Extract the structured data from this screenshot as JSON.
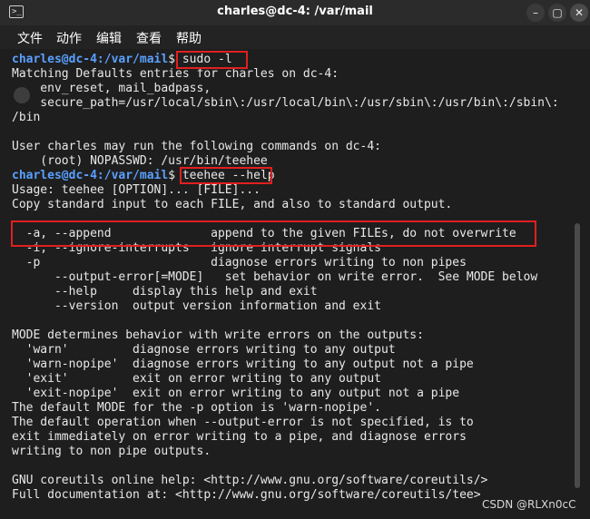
{
  "window": {
    "title": "charles@dc-4: /var/mail",
    "icon": "terminal-icon",
    "controls": {
      "minimize": "–",
      "maximize": "▢",
      "close": "✕"
    }
  },
  "menu": [
    "文件",
    "动作",
    "编辑",
    "查看",
    "帮助"
  ],
  "prompt": {
    "user": "charles@dc-4",
    "path": ":/var/mail",
    "symbol": "$"
  },
  "lines": [
    {
      "kind": "prompt",
      "cmd": " sudo -l"
    },
    {
      "kind": "text",
      "text": "Matching Defaults entries for charles on dc-4:"
    },
    {
      "kind": "text",
      "text": "    env_reset, mail_badpass,"
    },
    {
      "kind": "text",
      "text": "    secure_path=/usr/local/sbin\\:/usr/local/bin\\:/usr/sbin\\:/usr/bin\\:/sbin\\:"
    },
    {
      "kind": "text",
      "text": "/bin"
    },
    {
      "kind": "text",
      "text": ""
    },
    {
      "kind": "text",
      "text": "User charles may run the following commands on dc-4:"
    },
    {
      "kind": "text",
      "text": "    (root) NOPASSWD: /usr/bin/teehee"
    },
    {
      "kind": "prompt",
      "cmd": " teehee --help"
    },
    {
      "kind": "text",
      "text": "Usage: teehee [OPTION]... [FILE]..."
    },
    {
      "kind": "text",
      "text": "Copy standard input to each FILE, and also to standard output."
    },
    {
      "kind": "text",
      "text": ""
    },
    {
      "kind": "text",
      "text": "  -a, --append              append to the given FILEs, do not overwrite"
    },
    {
      "kind": "text",
      "text": "  -i, --ignore-interrupts   ignore interrupt signals"
    },
    {
      "kind": "text",
      "text": "  -p                        diagnose errors writing to non pipes"
    },
    {
      "kind": "text",
      "text": "      --output-error[=MODE]   set behavior on write error.  See MODE below"
    },
    {
      "kind": "text",
      "text": "      --help     display this help and exit"
    },
    {
      "kind": "text",
      "text": "      --version  output version information and exit"
    },
    {
      "kind": "text",
      "text": ""
    },
    {
      "kind": "text",
      "text": "MODE determines behavior with write errors on the outputs:"
    },
    {
      "kind": "text",
      "text": "  'warn'         diagnose errors writing to any output"
    },
    {
      "kind": "text",
      "text": "  'warn-nopipe'  diagnose errors writing to any output not a pipe"
    },
    {
      "kind": "text",
      "text": "  'exit'         exit on error writing to any output"
    },
    {
      "kind": "text",
      "text": "  'exit-nopipe'  exit on error writing to any output not a pipe"
    },
    {
      "kind": "text",
      "text": "The default MODE for the -p option is 'warn-nopipe'."
    },
    {
      "kind": "text",
      "text": "The default operation when --output-error is not specified, is to"
    },
    {
      "kind": "text",
      "text": "exit immediately on error writing to a pipe, and diagnose errors"
    },
    {
      "kind": "text",
      "text": "writing to non pipe outputs."
    },
    {
      "kind": "text",
      "text": ""
    },
    {
      "kind": "text",
      "text": "GNU coreutils online help: <http://www.gnu.org/software/coreutils/>"
    },
    {
      "kind": "text",
      "text": "Full documentation at: <http://www.gnu.org/software/coreutils/tee>"
    }
  ],
  "watermark": "CSDN @RLXn0cC",
  "colors": {
    "prompt": "#5aa0ff",
    "highlight_box": "#e02020",
    "background": "#1e1e1e",
    "text": "#e8e8e8"
  }
}
